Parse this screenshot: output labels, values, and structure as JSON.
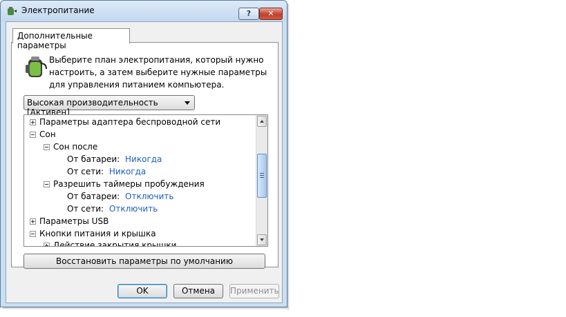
{
  "window": {
    "title": "Электропитание",
    "help_label": "?",
    "close_label": "✕"
  },
  "tab": {
    "label": "Дополнительные параметры"
  },
  "description": "Выберите план электропитания, который нужно настроить, а затем выберите нужные параметры для управления питанием компьютера.",
  "plan_select": {
    "selected": "Высокая производительность [Активен]"
  },
  "tree": {
    "rows": [
      {
        "label": "Параметры адаптера беспроводной сети",
        "value": ""
      },
      {
        "label": "Сон",
        "value": ""
      },
      {
        "label": "Сон после",
        "value": ""
      },
      {
        "label": "От батареи:",
        "value": "Никогда"
      },
      {
        "label": "От сети:",
        "value": "Никогда"
      },
      {
        "label": "Разрешить таймеры пробуждения",
        "value": ""
      },
      {
        "label": "От батареи:",
        "value": "Отключить"
      },
      {
        "label": "От сети:",
        "value": "Отключить"
      },
      {
        "label": "Параметры USB",
        "value": ""
      },
      {
        "label": "Кнопки питания и крышка",
        "value": ""
      },
      {
        "label": "Действие закрытия крышки",
        "value": ""
      }
    ]
  },
  "restore_button": "Восстановить параметры по умолчанию",
  "buttons": {
    "ok": "OK",
    "cancel": "Отмена",
    "apply": "Применить"
  },
  "icons": {
    "window_icon": "power-options-icon",
    "plan_icon": "battery-plug-icon"
  },
  "colors": {
    "link": "#1c5ec2",
    "frame": "#cbdff2"
  }
}
